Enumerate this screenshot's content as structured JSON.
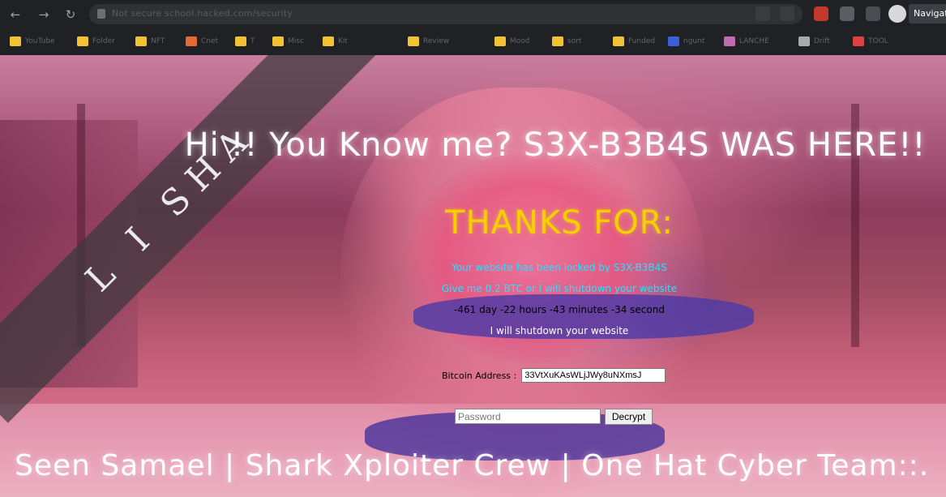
{
  "browser": {
    "url_text": "Not secure  school.hacked.com/security",
    "navigate_label": "Navigat",
    "bookmarks": [
      {
        "label": "YouTube",
        "color": "#f1c232"
      },
      {
        "label": "Folder",
        "color": "#f1c232"
      },
      {
        "label": "NFT",
        "color": "#f1c232"
      },
      {
        "label": "Cnet",
        "color": "#e06b35"
      },
      {
        "label": "T",
        "color": "#f1c232"
      },
      {
        "label": "Misc",
        "color": "#f1c232"
      },
      {
        "label": "Kit",
        "color": "#f1c232"
      },
      {
        "label": "Review",
        "color": "#f1c232"
      },
      {
        "label": "Mood",
        "color": "#f1c232"
      },
      {
        "label": "sort",
        "color": "#f1c232"
      },
      {
        "label": "Funded",
        "color": "#f1c232"
      },
      {
        "label": "ngunt",
        "color": "#3b5fd6"
      },
      {
        "label": "LANCHE",
        "color": "#c06bb0"
      },
      {
        "label": "Drift",
        "color": "#aaaaaa"
      },
      {
        "label": "TOOL",
        "color": "#e04040"
      }
    ]
  },
  "page": {
    "ribbon_text": "L I SHA",
    "headline": "Hi !! You Know me? S3X-B3B4S WAS HERE!!",
    "thanks": "THANKS FOR:",
    "line1": "Your website has been locked by S3X-B3B4S",
    "line2": "Give me 0.2 BTC or i will shutdown your website",
    "line3": "-461 day -22 hours -43 minutes -34 second",
    "line4": "I will shutdown your website",
    "bitcoin_label": "Bitcoin Address :",
    "bitcoin_value": "33VtXuKAsWLjJWy8uNXmsJ",
    "password_placeholder": "Password",
    "decrypt_label": "Decrypt",
    "footer": "Seen Samael | Shark Xploiter Crew | One Hat Cyber Team::."
  },
  "colors": {
    "accent_cyan": "#23e4ff",
    "accent_yellow": "#f5d000"
  }
}
